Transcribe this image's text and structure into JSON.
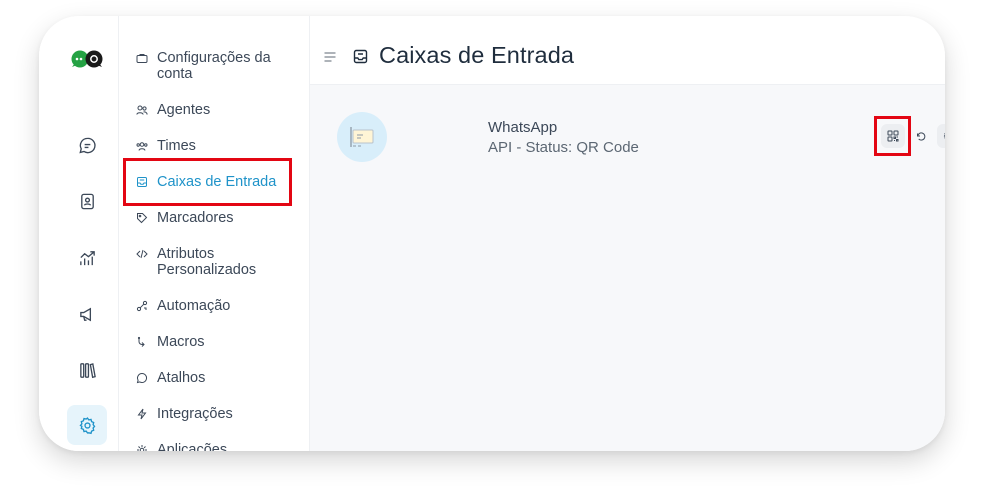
{
  "app": {
    "page_title": "Caixas de Entrada"
  },
  "rail": {
    "items": [
      {
        "name": "conversations",
        "icon": "chat-bubble-icon",
        "active": false
      },
      {
        "name": "contacts",
        "icon": "contact-book-icon",
        "active": false
      },
      {
        "name": "reports",
        "icon": "chart-icon",
        "active": false
      },
      {
        "name": "campaigns",
        "icon": "megaphone-icon",
        "active": false
      },
      {
        "name": "library",
        "icon": "library-icon",
        "active": false
      },
      {
        "name": "settings",
        "icon": "gear-icon",
        "active": true
      }
    ]
  },
  "sidebar": {
    "items": [
      {
        "label": "Configurações da conta",
        "icon": "briefcase-icon"
      },
      {
        "label": "Agentes",
        "icon": "people-icon"
      },
      {
        "label": "Times",
        "icon": "team-icon"
      },
      {
        "label": "Caixas de Entrada",
        "icon": "inbox-icon",
        "active": true
      },
      {
        "label": "Marcadores",
        "icon": "tag-icon"
      },
      {
        "label": "Atributos Personalizados",
        "icon": "code-icon"
      },
      {
        "label": "Automação",
        "icon": "automation-icon"
      },
      {
        "label": "Macros",
        "icon": "macro-icon"
      },
      {
        "label": "Atalhos",
        "icon": "chat-icon"
      },
      {
        "label": "Integrações",
        "icon": "lightning-icon"
      },
      {
        "label": "Aplicações",
        "icon": "apps-icon"
      }
    ]
  },
  "inbox": {
    "name": "WhatsApp",
    "status": "API - Status: QR Code",
    "actions": [
      {
        "name": "qr-code",
        "icon": "qr-code-icon",
        "highlighted": true
      },
      {
        "name": "refresh",
        "icon": "refresh-icon"
      },
      {
        "name": "settings",
        "icon": "gear-icon"
      }
    ]
  },
  "colors": {
    "accent": "#1f93c9",
    "highlight_box": "#e30613",
    "logo_green": "#25a244"
  }
}
